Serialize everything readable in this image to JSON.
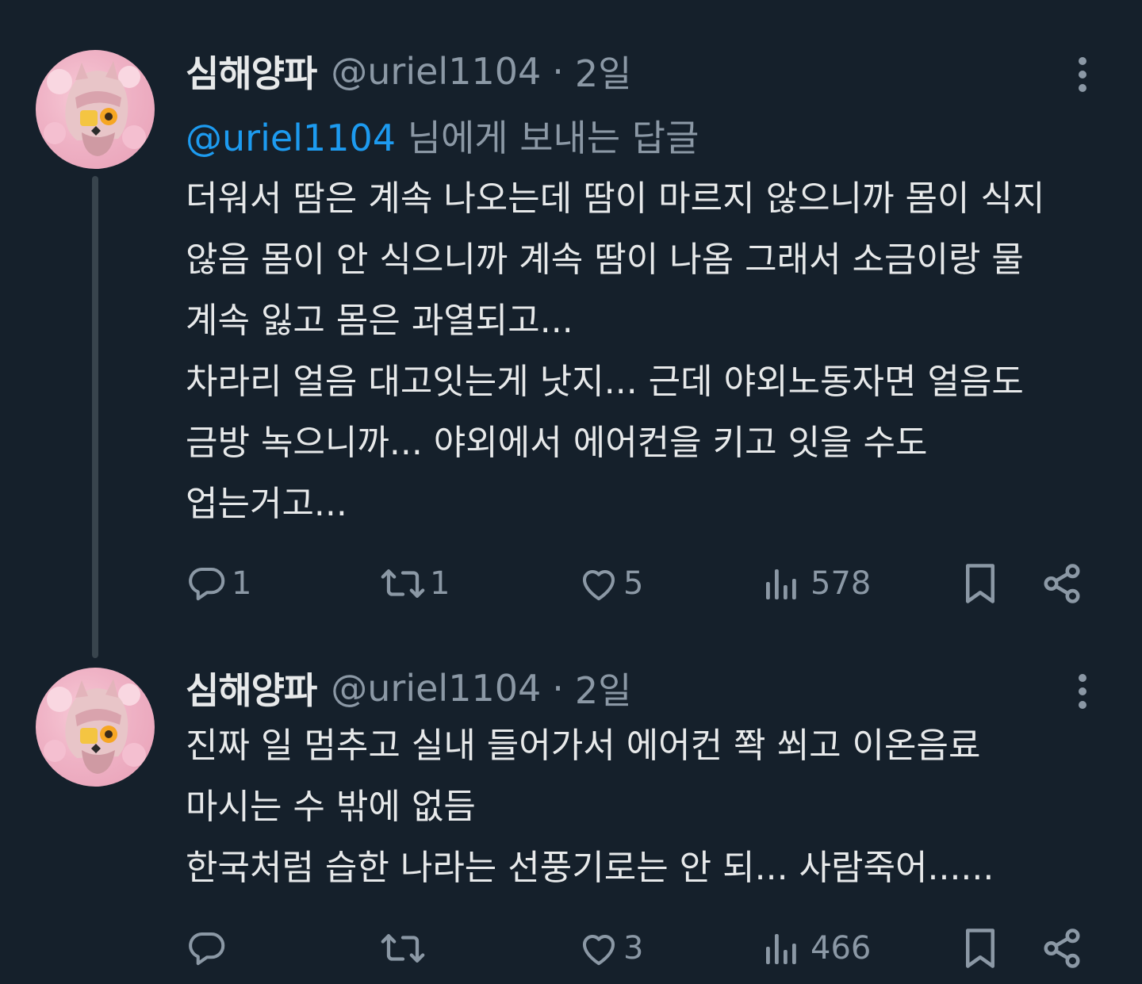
{
  "colors": {
    "background": "#15202b",
    "text_primary": "#e7e9ea",
    "text_secondary": "#8b98a5",
    "mention": "#1d9bf0",
    "thread_line": "#38444d"
  },
  "tweets": [
    {
      "display_name": "심해양파",
      "handle": "@uriel1104",
      "separator": "·",
      "time": "2일",
      "replying_to": {
        "mention": "@uriel1104",
        "suffix": " 님에게 보내는 답글"
      },
      "lines": [
        "더워서 땀은 계속 나오는데 땀이 마르지 않으니까 몸이 식지",
        "않음 몸이 안 식으니까 계속 땀이 나옴 그래서 소금이랑 물",
        "계속 잃고 몸은 과열되고...",
        "차라리 얼음 대고잇는게 낫지... 근데 야외노동자면 얼음도",
        "금방 녹으니까... 야외에서 에어컨을 키고 잇을 수도",
        "업는거고..."
      ],
      "actions": {
        "replies": "1",
        "retweets": "1",
        "likes": "5",
        "views": "578"
      },
      "icons": [
        "more-icon",
        "reply-icon",
        "retweet-icon",
        "heart-icon",
        "views-icon",
        "bookmark-icon",
        "share-icon"
      ]
    },
    {
      "display_name": "심해양파",
      "handle": "@uriel1104",
      "separator": "·",
      "time": "2일",
      "lines": [
        "진짜 일 멈추고 실내 들어가서 에어컨 쫙 쐬고 이온음료",
        "마시는 수 밖에 없듬",
        "한국처럼 습한 나라는 선풍기로는 안 되... 사람죽어......"
      ],
      "actions": {
        "replies": "",
        "retweets": "",
        "likes": "3",
        "views": "466"
      },
      "icons": [
        "more-icon",
        "reply-icon",
        "retweet-icon",
        "heart-icon",
        "views-icon",
        "bookmark-icon",
        "share-icon"
      ]
    }
  ]
}
